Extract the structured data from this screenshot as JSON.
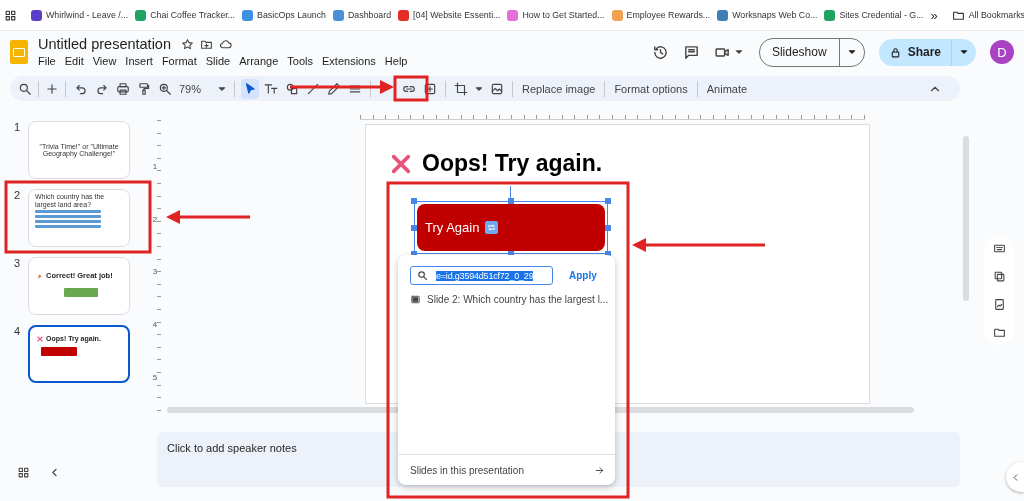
{
  "bookmarks": {
    "items": [
      {
        "label": "Whirlwind - Leave /...",
        "color": "#5b3ec8"
      },
      {
        "label": "Chai Coffee Tracker...",
        "color": "#1ea362"
      },
      {
        "label": "BasicOps Launch",
        "color": "#3d8fe0"
      },
      {
        "label": "Dashboard",
        "color": "#4a8fd8"
      },
      {
        "label": "[04] Website Essenti...",
        "color": "#e52d27"
      },
      {
        "label": "How to Get Started...",
        "color": "#e36fd9"
      },
      {
        "label": "Employee Rewards...",
        "color": "#f0a050"
      },
      {
        "label": "Worksnaps Web Co...",
        "color": "#3f7fb8"
      },
      {
        "label": "Sites Credential - G...",
        "color": "#1ea362"
      }
    ],
    "more": "»",
    "all": "All Bookmarks"
  },
  "document": {
    "title": "Untitled presentation",
    "menu": [
      "File",
      "Edit",
      "View",
      "Insert",
      "Format",
      "Slide",
      "Arrange",
      "Tools",
      "Extensions",
      "Help"
    ]
  },
  "header": {
    "slideshow": "Slideshow",
    "share": "Share",
    "avatar": "D"
  },
  "toolbar": {
    "zoom": "79%",
    "tools": [
      {
        "selected": true
      },
      {
        "selected": false
      },
      {
        "selected": false
      },
      {
        "selected": false
      }
    ],
    "actions": [
      "Replace image",
      "Format options",
      "Animate"
    ]
  },
  "filmstrip": [
    {
      "number": "1",
      "kind": "title",
      "title": "\"Trivia Time!\" or \"Ultimate Geography Challenge!\"",
      "selected": false
    },
    {
      "number": "2",
      "kind": "question",
      "title": "Which country has the largest land area?",
      "selected": false
    },
    {
      "number": "3",
      "kind": "correct",
      "title": "Correct! Great job!",
      "selected": false
    },
    {
      "number": "4",
      "kind": "wrong",
      "title": "Oops! Try again.",
      "selected": true
    }
  ],
  "rulers": {
    "vertical": [
      "1",
      "2",
      "3",
      "4",
      "5"
    ]
  },
  "slide": {
    "heading": "Oops! Try again.",
    "button": "Try Again"
  },
  "link_popup": {
    "value": "e=id.g3594d51cf72_0_29",
    "apply": "Apply",
    "results": [
      "Slide 2: Which country has the largest l..."
    ],
    "footer": "Slides in this presentation"
  },
  "notes": {
    "placeholder": "Click to add speaker notes"
  }
}
